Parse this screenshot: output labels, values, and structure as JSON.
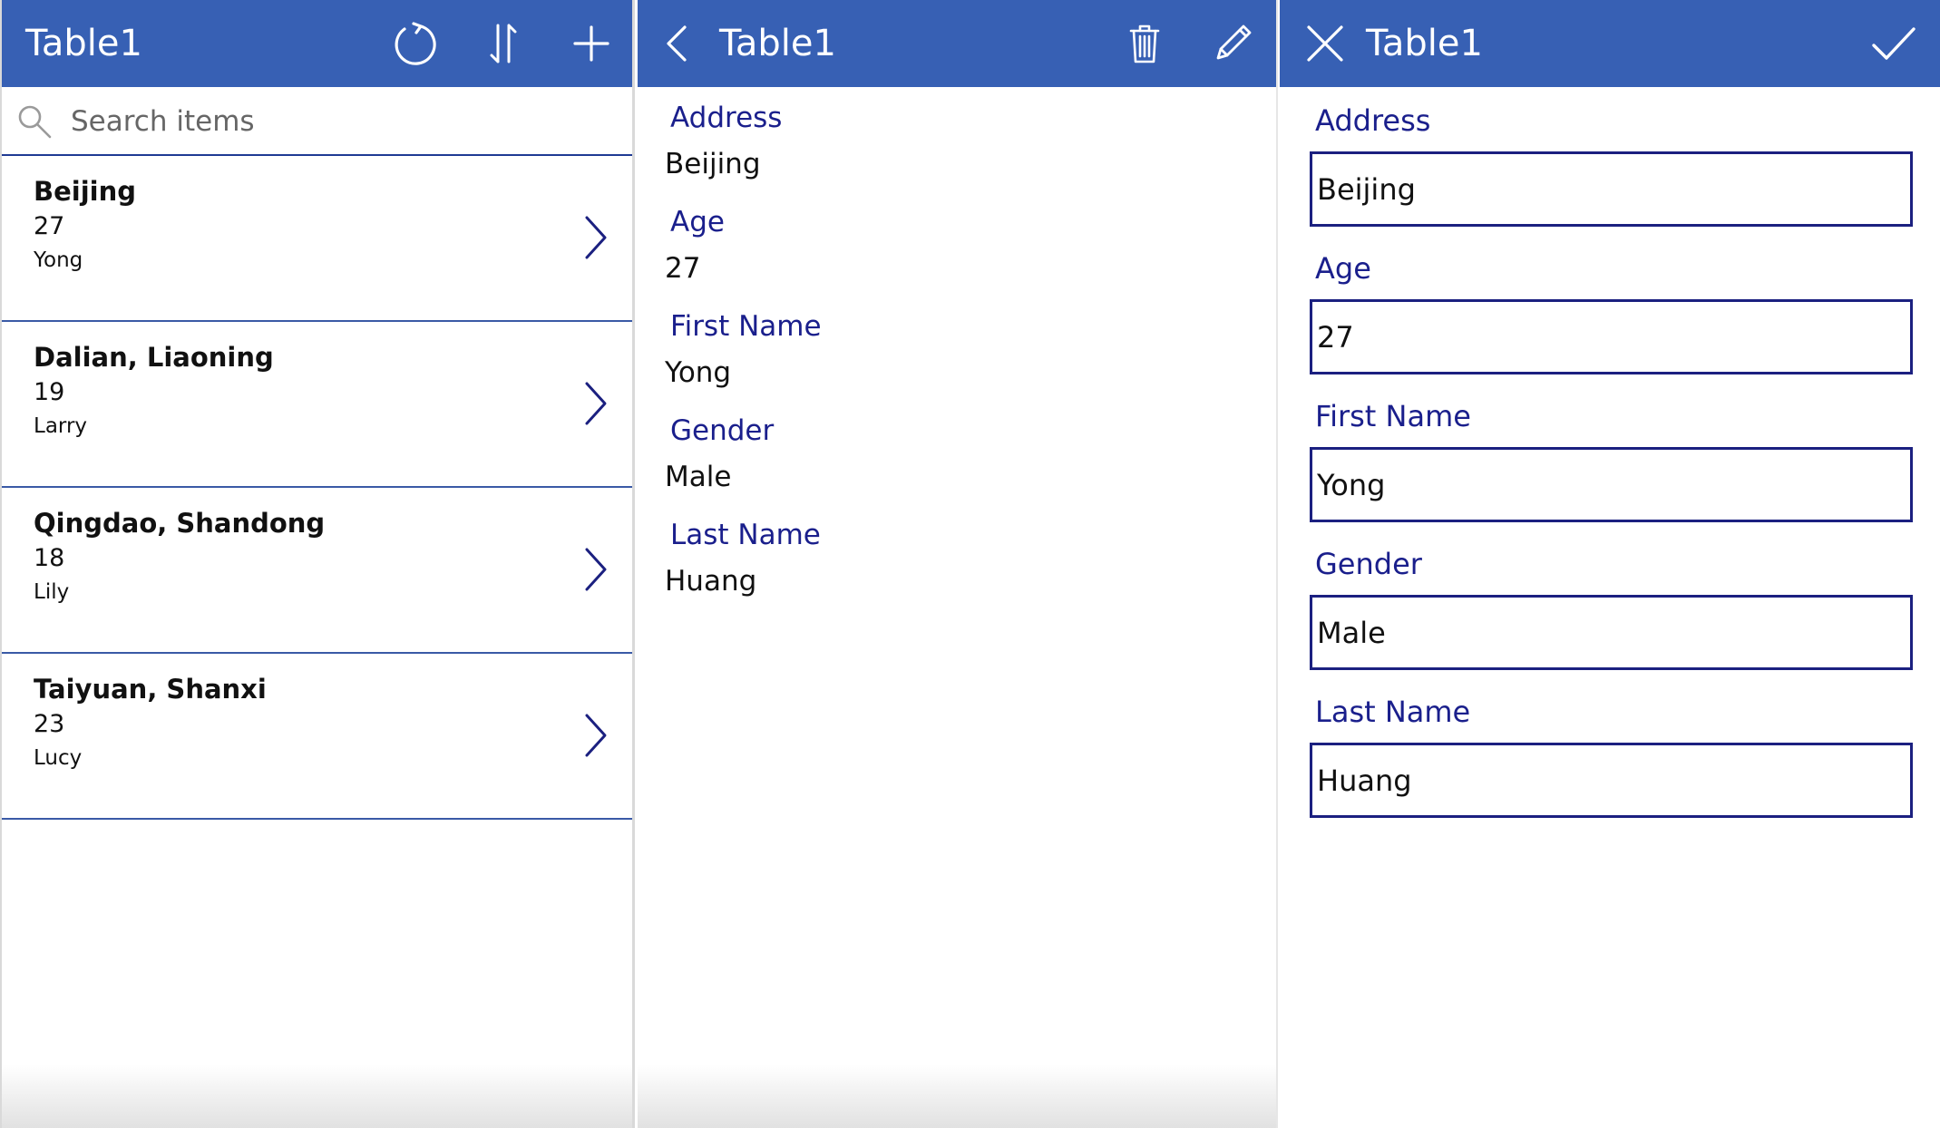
{
  "browse": {
    "title": "Table1",
    "icons": {
      "refresh": "refresh-icon",
      "sort": "sort-icon",
      "add": "plus-icon"
    },
    "search_placeholder": "Search items",
    "items": [
      {
        "address": "Beijing",
        "age": "27",
        "first_name": "Yong"
      },
      {
        "address": "Dalian, Liaoning",
        "age": "19",
        "first_name": "Larry"
      },
      {
        "address": "Qingdao, Shandong",
        "age": "18",
        "first_name": "Lily"
      },
      {
        "address": "Taiyuan, Shanxi",
        "age": "23",
        "first_name": "Lucy"
      }
    ]
  },
  "detail": {
    "title": "Table1",
    "icons": {
      "back": "chevron-left-icon",
      "delete": "trash-icon",
      "edit": "pencil-icon"
    },
    "fields": [
      {
        "label": "Address",
        "value": "Beijing"
      },
      {
        "label": "Age",
        "value": "27"
      },
      {
        "label": "First Name",
        "value": "Yong"
      },
      {
        "label": "Gender",
        "value": "Male"
      },
      {
        "label": "Last Name",
        "value": "Huang"
      }
    ]
  },
  "edit": {
    "title": "Table1",
    "icons": {
      "cancel": "close-icon",
      "submit": "check-icon"
    },
    "fields": [
      {
        "label": "Address",
        "value": "Beijing"
      },
      {
        "label": "Age",
        "value": "27"
      },
      {
        "label": "First Name",
        "value": "Yong"
      },
      {
        "label": "Gender",
        "value": "Male"
      },
      {
        "label": "Last Name",
        "value": "Huang"
      }
    ]
  },
  "colors": {
    "header": "#3760b4",
    "accent": "#1a1f8c",
    "divider": "#3a5aa6"
  }
}
